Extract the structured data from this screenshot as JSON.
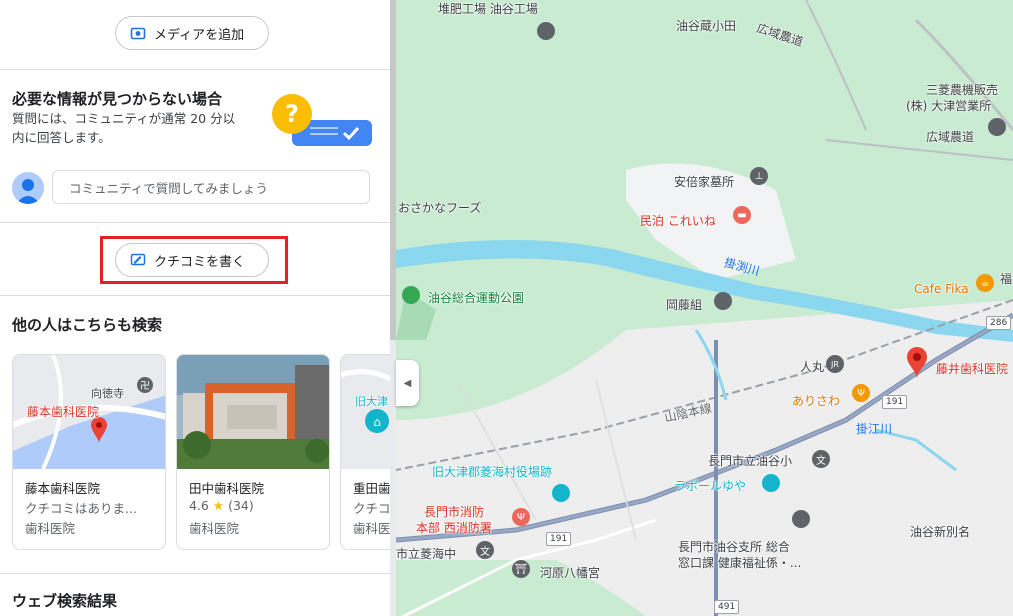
{
  "panel": {
    "add_media_label": "メディアを追加",
    "info_title": "必要な情報が見つからない場合",
    "info_text_1": "質問には、コミュニティが通常 20 分以",
    "info_text_2": "内に回答します。",
    "ask_placeholder": "コミュニティで質問してみましょう",
    "write_review_label": "クチコミを書く",
    "also_search_title": "他の人はこちらも検索",
    "web_results_title": "ウェブ検索結果",
    "cards": [
      {
        "name": "藤本歯科医院",
        "line2": "クチコミはありま...",
        "category": "歯科医院",
        "map_label": "藤本歯科医院",
        "map_label2": "向徳寺"
      },
      {
        "name": "田中歯科医院",
        "rating": "4.6",
        "star": "★",
        "count": "(34)",
        "category": "歯科医院"
      },
      {
        "name": "重田歯",
        "line2": "クチコ",
        "category": "歯科医",
        "map_label": "旧大津"
      }
    ],
    "colors": {
      "highlight": "#e3202a",
      "accent": "#1a73e8"
    }
  },
  "map": {
    "labels": {
      "taihi": "堆肥工場 油谷工場",
      "yuyazoko": "油谷蔵小田",
      "kouiki1": "広域農道",
      "mitsubishi1": "三菱農機販売",
      "mitsubishi2": "(株) 大津営業所",
      "kouiki2": "広域農道",
      "abeke": "安倍家墓所",
      "osakana": "おさかなフーズ",
      "minpaku": "民泊 これいね",
      "kakebuchi": "掛渕川",
      "cafe": "Cafe Fika",
      "undoukouen": "油谷総合運動公園",
      "okafuji": "岡藤組",
      "hitomaru": "人丸",
      "fujii": "藤井歯科医院",
      "arisawa": "ありさわ",
      "sanin": "山陰本線",
      "nagamiyu": "長門市立油谷小",
      "kyuootsu": "旧大津郡菱海村役場跡",
      "rapor": "ラポールゆや",
      "shobo1": "長門市消防",
      "shobo2": "本部 西消防署",
      "yuyashin": "油谷新別名",
      "sogo1": "長門市油谷支所 総合",
      "sogo2": "窓口課 健康福祉係・...",
      "hishikai": "市立菱海中",
      "kawahara": "河原八幡宮",
      "niegawa": "掛江川",
      "fuku": "福"
    },
    "shields": {
      "r286": "286",
      "r191a": "191",
      "r191b": "191",
      "r491": "491"
    },
    "icons": [
      "pin-icon",
      "temple-icon",
      "hotel-icon",
      "park-icon",
      "cafe-icon",
      "restaurant-icon",
      "school-icon",
      "landmark-icon",
      "fire-station-icon",
      "dentist-pin-icon",
      "shrine-icon",
      "train-icon"
    ]
  }
}
